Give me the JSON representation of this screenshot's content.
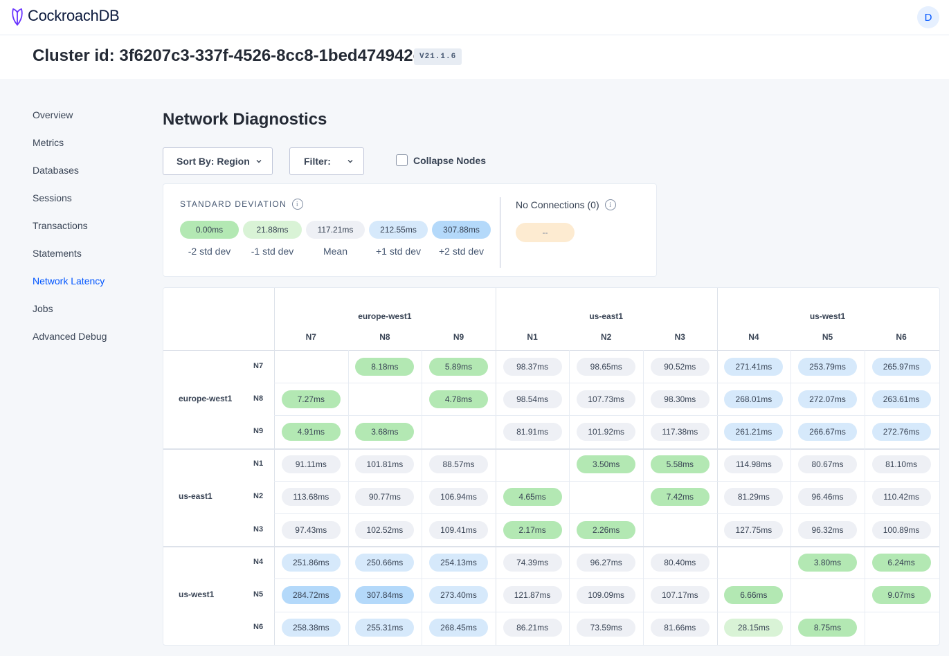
{
  "app": {
    "name": "CockroachDB",
    "user_initial": "D"
  },
  "header": {
    "cluster_title": "Cluster id: 3f6207c3-337f-4526-8cc8-1bed474942ed",
    "version": "V21.1.6"
  },
  "sidebar": {
    "items": [
      {
        "label": "Overview",
        "active": false
      },
      {
        "label": "Metrics",
        "active": false
      },
      {
        "label": "Databases",
        "active": false
      },
      {
        "label": "Sessions",
        "active": false
      },
      {
        "label": "Transactions",
        "active": false
      },
      {
        "label": "Statements",
        "active": false
      },
      {
        "label": "Network Latency",
        "active": true
      },
      {
        "label": "Jobs",
        "active": false
      },
      {
        "label": "Advanced Debug",
        "active": false
      }
    ]
  },
  "page": {
    "title": "Network Diagnostics"
  },
  "controls": {
    "sort_label": "Sort By: Region",
    "filter_label": "Filter:",
    "collapse_label": "Collapse Nodes",
    "collapse_checked": false
  },
  "legend": {
    "title": "STANDARD DEVIATION",
    "items": [
      {
        "value": "0.00ms",
        "label": "-2 std dev",
        "tone": "g2"
      },
      {
        "value": "21.88ms",
        "label": "-1 std dev",
        "tone": "g1"
      },
      {
        "value": "117.21ms",
        "label": "Mean",
        "tone": "mean"
      },
      {
        "value": "212.55ms",
        "label": "+1 std dev",
        "tone": "b1"
      },
      {
        "value": "307.88ms",
        "label": "+2 std dev",
        "tone": "b2"
      }
    ],
    "no_connections_label": "No Connections (0)",
    "no_connections_value": "--"
  },
  "colors": {
    "accent": "#0055ff",
    "g2": "#b3e8b3",
    "g1": "#d9f3d6",
    "mean": "#eef0f5",
    "b1": "#d6e9fb",
    "b2": "#b4d9fa",
    "noconn": "#fdebd1"
  },
  "matrix": {
    "regions": [
      {
        "name": "europe-west1",
        "nodes": [
          "N7",
          "N8",
          "N9"
        ]
      },
      {
        "name": "us-east1",
        "nodes": [
          "N1",
          "N2",
          "N3"
        ]
      },
      {
        "name": "us-west1",
        "nodes": [
          "N4",
          "N5",
          "N6"
        ]
      }
    ],
    "rows": [
      {
        "region": "europe-west1",
        "node": "N7",
        "cells": [
          null,
          "8.18ms",
          "5.89ms",
          "98.37ms",
          "98.65ms",
          "90.52ms",
          "271.41ms",
          "253.79ms",
          "265.97ms"
        ]
      },
      {
        "region": "europe-west1",
        "node": "N8",
        "cells": [
          "7.27ms",
          null,
          "4.78ms",
          "98.54ms",
          "107.73ms",
          "98.30ms",
          "268.01ms",
          "272.07ms",
          "263.61ms"
        ]
      },
      {
        "region": "europe-west1",
        "node": "N9",
        "cells": [
          "4.91ms",
          "3.68ms",
          null,
          "81.91ms",
          "101.92ms",
          "117.38ms",
          "261.21ms",
          "266.67ms",
          "272.76ms"
        ]
      },
      {
        "region": "us-east1",
        "node": "N1",
        "cells": [
          "91.11ms",
          "101.81ms",
          "88.57ms",
          null,
          "3.50ms",
          "5.58ms",
          "114.98ms",
          "80.67ms",
          "81.10ms"
        ]
      },
      {
        "region": "us-east1",
        "node": "N2",
        "cells": [
          "113.68ms",
          "90.77ms",
          "106.94ms",
          "4.65ms",
          null,
          "7.42ms",
          "81.29ms",
          "96.46ms",
          "110.42ms"
        ]
      },
      {
        "region": "us-east1",
        "node": "N3",
        "cells": [
          "97.43ms",
          "102.52ms",
          "109.41ms",
          "2.17ms",
          "2.26ms",
          null,
          "127.75ms",
          "96.32ms",
          "100.89ms"
        ]
      },
      {
        "region": "us-west1",
        "node": "N4",
        "cells": [
          "251.86ms",
          "250.66ms",
          "254.13ms",
          "74.39ms",
          "96.27ms",
          "80.40ms",
          null,
          "3.80ms",
          "6.24ms"
        ]
      },
      {
        "region": "us-west1",
        "node": "N5",
        "cells": [
          "284.72ms",
          "307.84ms",
          "273.40ms",
          "121.87ms",
          "109.09ms",
          "107.17ms",
          "6.66ms",
          null,
          "9.07ms"
        ]
      },
      {
        "region": "us-west1",
        "node": "N6",
        "cells": [
          "258.38ms",
          "255.31ms",
          "268.45ms",
          "86.21ms",
          "73.59ms",
          "81.66ms",
          "28.15ms",
          "8.75ms",
          null
        ]
      }
    ]
  }
}
